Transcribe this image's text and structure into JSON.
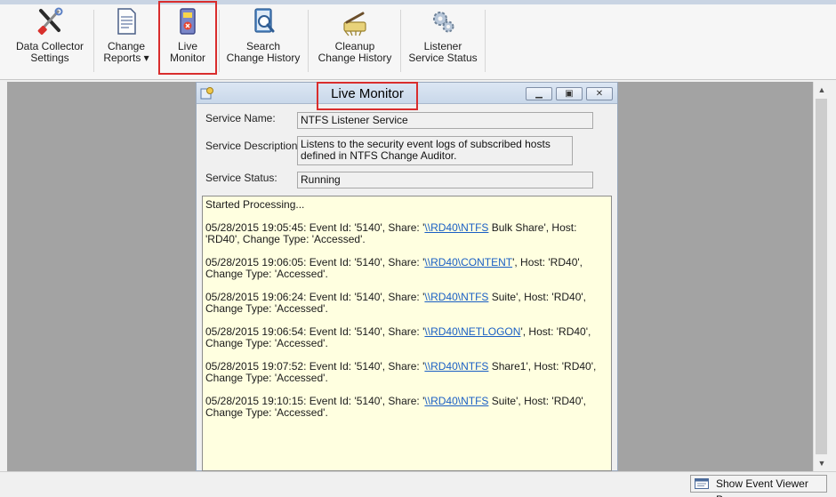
{
  "ribbon": {
    "buttons": [
      {
        "label": "Data Collector\nSettings",
        "icon": "tools-icon"
      },
      {
        "label": "Change\nReports ▾",
        "icon": "report-document-icon"
      },
      {
        "label": "Live\nMonitor",
        "icon": "live-monitor-icon"
      },
      {
        "label": "Search\nChange History",
        "icon": "search-history-icon"
      },
      {
        "label": "Cleanup\nChange History",
        "icon": "cleanup-broom-icon"
      },
      {
        "label": "Listener\nService Status",
        "icon": "service-gears-icon"
      }
    ]
  },
  "window": {
    "title": "Live Monitor",
    "controls": {
      "minimize": "minimize-icon",
      "restore": "restore-icon",
      "close": "close-icon"
    }
  },
  "service": {
    "name_label": "Service Name:",
    "name_value": "NTFS Listener Service",
    "description_label": "Service Description:",
    "description_value": "Listens to the security event logs of subscribed hosts defined in NTFS Change Auditor.",
    "status_label": "Service Status:",
    "status_value": "Running"
  },
  "log": {
    "header": "Started Processing...",
    "entries": [
      {
        "pre": "05/28/2015 19:05:45: Event Id: '5140', Share: '",
        "link": "\\\\RD40\\NTFS",
        "post": " Bulk Share', Host: 'RD40', Change Type: 'Accessed'."
      },
      {
        "pre": "05/28/2015 19:06:05: Event Id: '5140', Share: '",
        "link": "\\\\RD40\\CONTENT",
        "post": "', Host: 'RD40', Change Type: 'Accessed'."
      },
      {
        "pre": "05/28/2015 19:06:24: Event Id: '5140', Share: '",
        "link": "\\\\RD40\\NTFS",
        "post": " Suite', Host: 'RD40', Change Type: 'Accessed'."
      },
      {
        "pre": "05/28/2015 19:06:54: Event Id: '5140', Share: '",
        "link": "\\\\RD40\\NETLOGON",
        "post": "', Host: 'RD40', Change Type: 'Accessed'."
      },
      {
        "pre": "05/28/2015 19:07:52: Event Id: '5140', Share: '",
        "link": "\\\\RD40\\NTFS",
        "post": " Share1', Host: 'RD40', Change Type: 'Accessed'."
      },
      {
        "pre": "05/28/2015 19:10:15: Event Id: '5140', Share: '",
        "link": "\\\\RD40\\NTFS",
        "post": " Suite', Host: 'RD40', Change Type: 'Accessed'."
      }
    ]
  },
  "statusbar": {
    "event_viewer_label": "Show Event Viewer Pane"
  },
  "colors": {
    "highlight": "#d92d2d",
    "log_background": "#ffffe0",
    "link": "#1a5fc4",
    "workspace": "#a3a3a3"
  }
}
